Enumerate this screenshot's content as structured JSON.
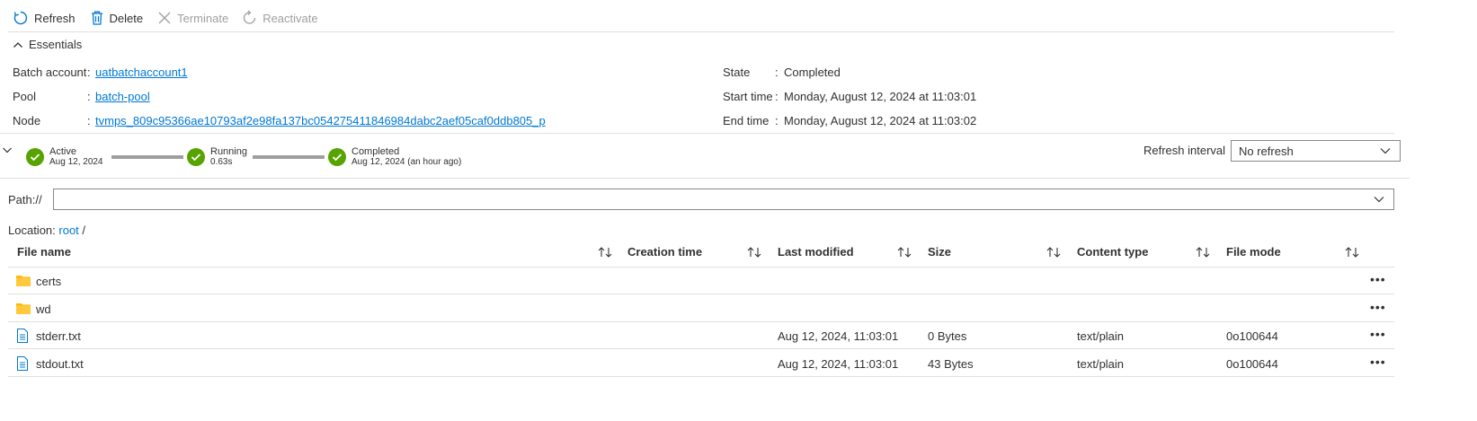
{
  "toolbar": {
    "refresh_label": "Refresh",
    "delete_label": "Delete",
    "terminate_label": "Terminate",
    "reactivate_label": "Reactivate"
  },
  "essentials": {
    "title": "Essentials",
    "left": [
      {
        "label": "Batch account",
        "value": "uatbatchaccount1"
      },
      {
        "label": "Pool",
        "value": "batch-pool"
      },
      {
        "label": "Node",
        "value": "tvmps_809c95366ae10793af2e98fa137bc054275411846984dabc2aef05caf0ddb805_p"
      }
    ],
    "right": [
      {
        "label": "State",
        "value": "Completed"
      },
      {
        "label": "Start time",
        "value": "Monday, August 12, 2024 at 11:03:01"
      },
      {
        "label": "End time",
        "value": "Monday, August 12, 2024 at 11:03:02"
      }
    ],
    "colon": ":"
  },
  "timeline": {
    "steps": [
      {
        "title": "Active",
        "sub": "Aug 12, 2024"
      },
      {
        "title": "Running",
        "sub": "0.63s"
      },
      {
        "title": "Completed",
        "sub": "Aug 12, 2024 (an hour ago)"
      }
    ],
    "refresh_interval_label": "Refresh interval",
    "refresh_interval_value": "No refresh"
  },
  "path": {
    "label": "Path://",
    "value": ""
  },
  "location": {
    "label": "Location:",
    "root": "root",
    "sep": "/"
  },
  "table": {
    "columns": [
      "File name",
      "Creation time",
      "Last modified",
      "Size",
      "Content type",
      "File mode"
    ],
    "rows": [
      {
        "type": "folder",
        "name": "certs",
        "created": "",
        "modified": "",
        "size": "",
        "content_type": "",
        "mode": ""
      },
      {
        "type": "folder",
        "name": "wd",
        "created": "",
        "modified": "",
        "size": "",
        "content_type": "",
        "mode": ""
      },
      {
        "type": "file",
        "name": "stderr.txt",
        "created": "",
        "modified": "Aug 12, 2024, 11:03:01",
        "size": "0 Bytes",
        "content_type": "text/plain",
        "mode": "0o100644"
      },
      {
        "type": "file",
        "name": "stdout.txt",
        "created": "",
        "modified": "Aug 12, 2024, 11:03:01",
        "size": "43 Bytes",
        "content_type": "text/plain",
        "mode": "0o100644"
      }
    ],
    "more_label": "•••"
  },
  "colors": {
    "accent": "#0078d4",
    "success": "#57a300",
    "folder": "#ffb900",
    "border": "#e1dfdd"
  },
  "icons": [
    "refresh-icon",
    "delete-icon",
    "terminate-icon",
    "reactivate-icon",
    "chevron-up-icon",
    "chevron-down-icon",
    "checkmark-icon",
    "sort-icon",
    "folder-icon",
    "file-icon",
    "more-icon"
  ]
}
